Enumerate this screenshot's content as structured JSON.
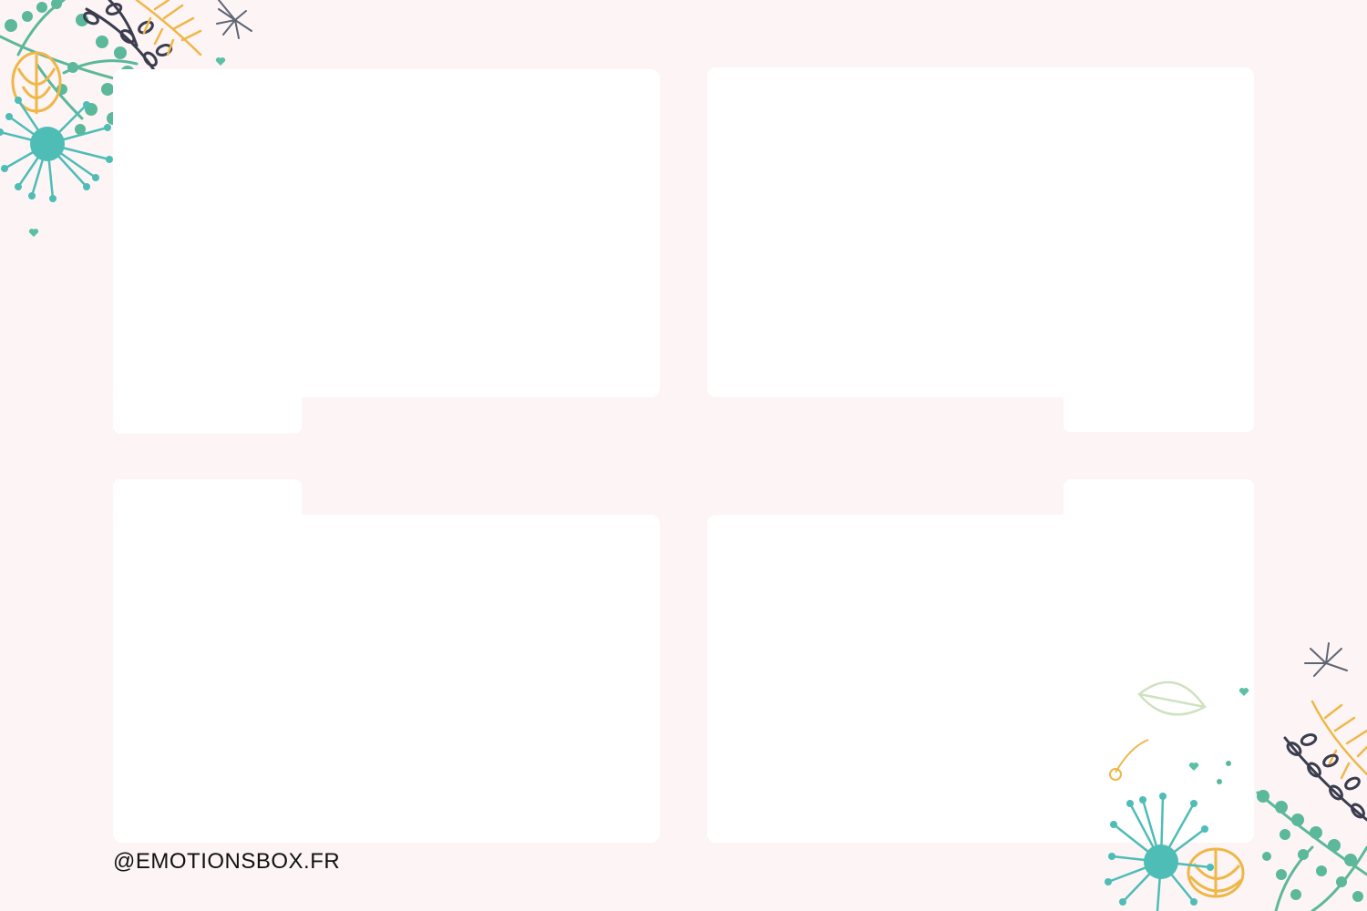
{
  "brand": {
    "handle": "@EMOTIONSBOX.FR"
  },
  "photo_slots": [
    "photo-1",
    "photo-2",
    "photo-3",
    "photo-4"
  ],
  "colors": {
    "background": "#fdf4f5",
    "frame": "#ffffff",
    "teal": "#4dbdb6",
    "green": "#5bb89b",
    "gold": "#eeb748",
    "navy": "#3a3d4e",
    "leaf": "#cfe2bf"
  },
  "decorations": {
    "top_left": "floral-corner-icon",
    "bottom_right": "floral-corner-icon"
  }
}
